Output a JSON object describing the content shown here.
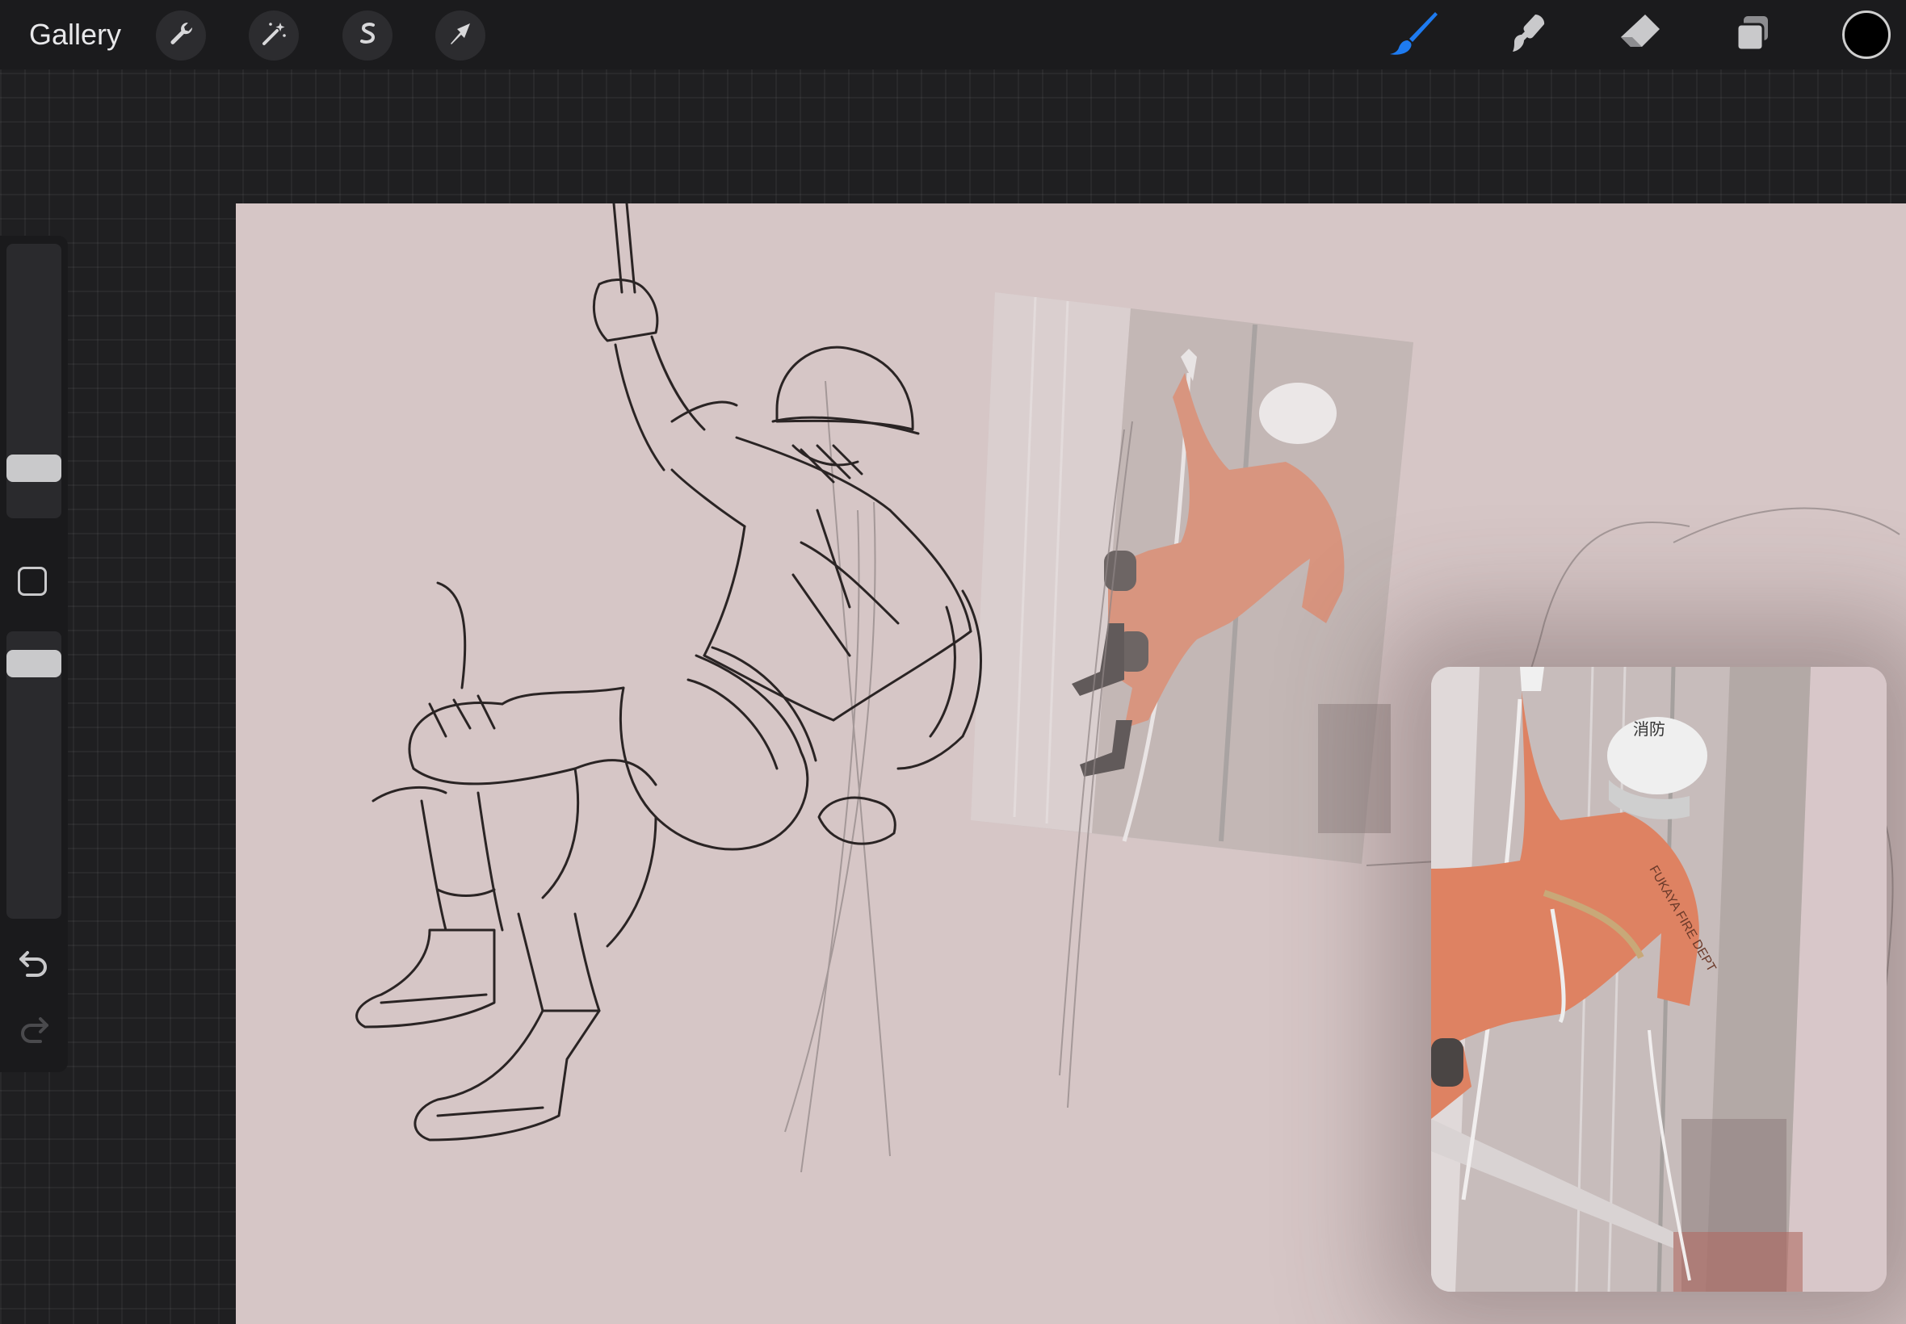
{
  "app": "Procreate",
  "toolbar": {
    "gallery_label": "Gallery",
    "left_tools": [
      "wrench-icon",
      "magic-wand-icon",
      "selection-s-icon",
      "transform-arrow-icon"
    ],
    "right_tools": [
      "brush-icon",
      "smudge-icon",
      "eraser-icon",
      "layers-icon"
    ],
    "active_tool": "brush",
    "active_color": "#000000",
    "accent_color": "#1e7bf0"
  },
  "sidebar": {
    "brush_size_level": 0.25,
    "opacity_level": 0.88,
    "buttons": [
      "modify-square",
      "undo-icon",
      "redo-icon"
    ]
  },
  "canvas": {
    "background_color": "#d6c6c6",
    "content": "pencil sketch of a firefighter rappelling on a rope"
  },
  "reference": {
    "image_subject": "rescue worker in orange uniform and white helmet rappelling down a building wall",
    "helmet_text": "消防",
    "uniform_text": "FUKAYA FIRE DEPT"
  },
  "colors": {
    "uniform_orange": "#d97b5f",
    "helmet_white": "#eeeeee"
  }
}
